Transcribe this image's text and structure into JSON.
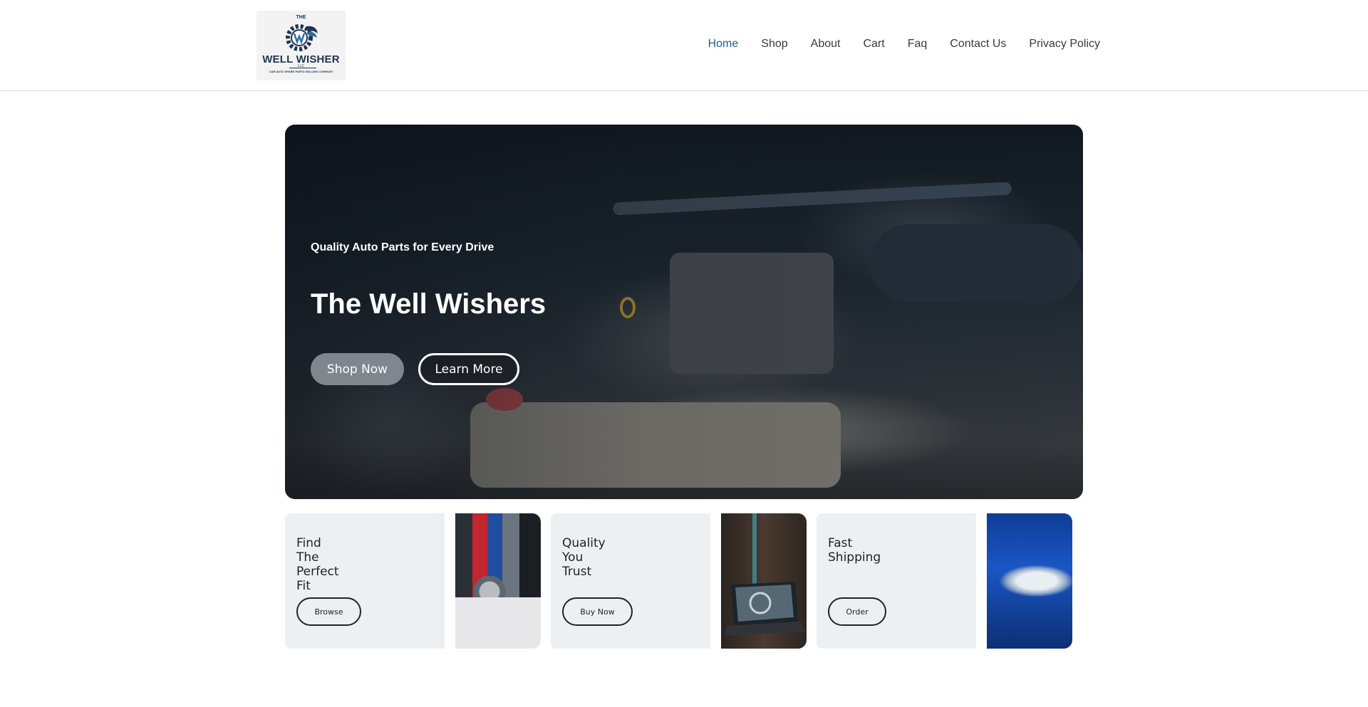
{
  "logo": {
    "top_text": "THE",
    "name": "WELL WISHER",
    "llc": "LLC",
    "tagline": "CAR AUTO SPARE PARTS SELLING COMPANY"
  },
  "nav": {
    "items": [
      "Home",
      "Shop",
      "About",
      "Cart",
      "Faq",
      "Contact Us",
      "Privacy Policy"
    ],
    "active": "Home"
  },
  "hero": {
    "subtitle": "Quality Auto Parts for Every Drive",
    "title": "The Well Wishers",
    "primary_button": "Shop Now",
    "secondary_button": "Learn More"
  },
  "cards": [
    {
      "heading": "Find The Perfect Fit",
      "button": "Browse"
    },
    {
      "heading": "Quality You Trust",
      "button": "Buy Now"
    },
    {
      "heading": "Fast Shipping",
      "button": "Order"
    }
  ],
  "colors": {
    "nav_active": "#1f5f8b",
    "brand_navy": "#1e3550",
    "card_bg": "#edf0f3",
    "shop_button": "#7f868d"
  }
}
